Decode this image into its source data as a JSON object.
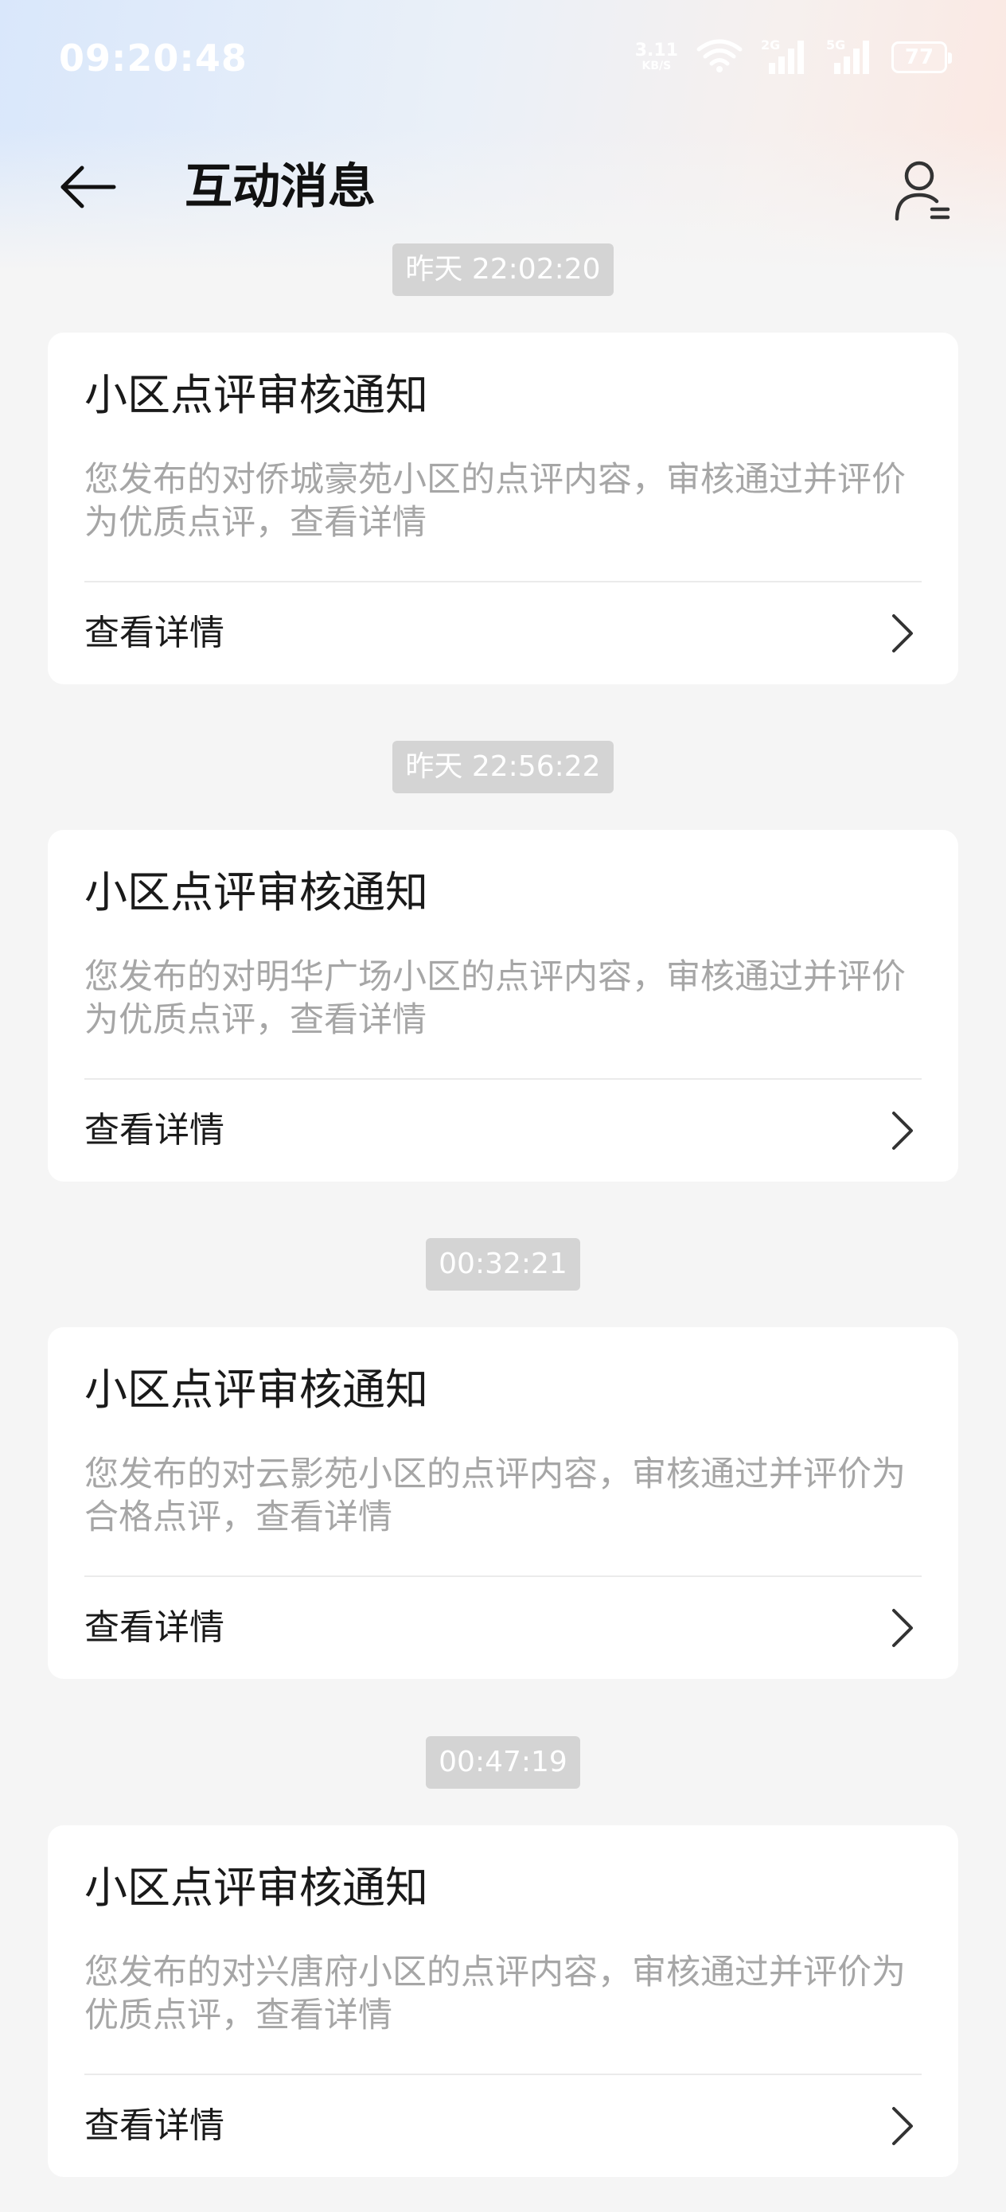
{
  "status_bar": {
    "time": "09:20:48",
    "net_speed": "3.11",
    "net_speed_unit": "KB/S",
    "sim1_tag": "2G",
    "sim2_tag": "5G",
    "battery": "77"
  },
  "header": {
    "title": "互动消息"
  },
  "messages": [
    {
      "time": "昨天 22:02:20",
      "title": "小区点评审核通知",
      "desc": "您发布的对侨城豪苑小区的点评内容，审核通过并评价为优质点评，查看详情",
      "link_label": "查看详情"
    },
    {
      "time": "昨天 22:56:22",
      "title": "小区点评审核通知",
      "desc": "您发布的对明华广场小区的点评内容，审核通过并评价为优质点评，查看详情",
      "link_label": "查看详情"
    },
    {
      "time": "00:32:21",
      "title": "小区点评审核通知",
      "desc": "您发布的对云影苑小区的点评内容，审核通过并评价为合格点评，查看详情",
      "link_label": "查看详情"
    },
    {
      "time": "00:47:19",
      "title": "小区点评审核通知",
      "desc": "您发布的对兴唐府小区的点评内容，审核通过并评价为优质点评，查看详情",
      "link_label": "查看详情"
    }
  ]
}
